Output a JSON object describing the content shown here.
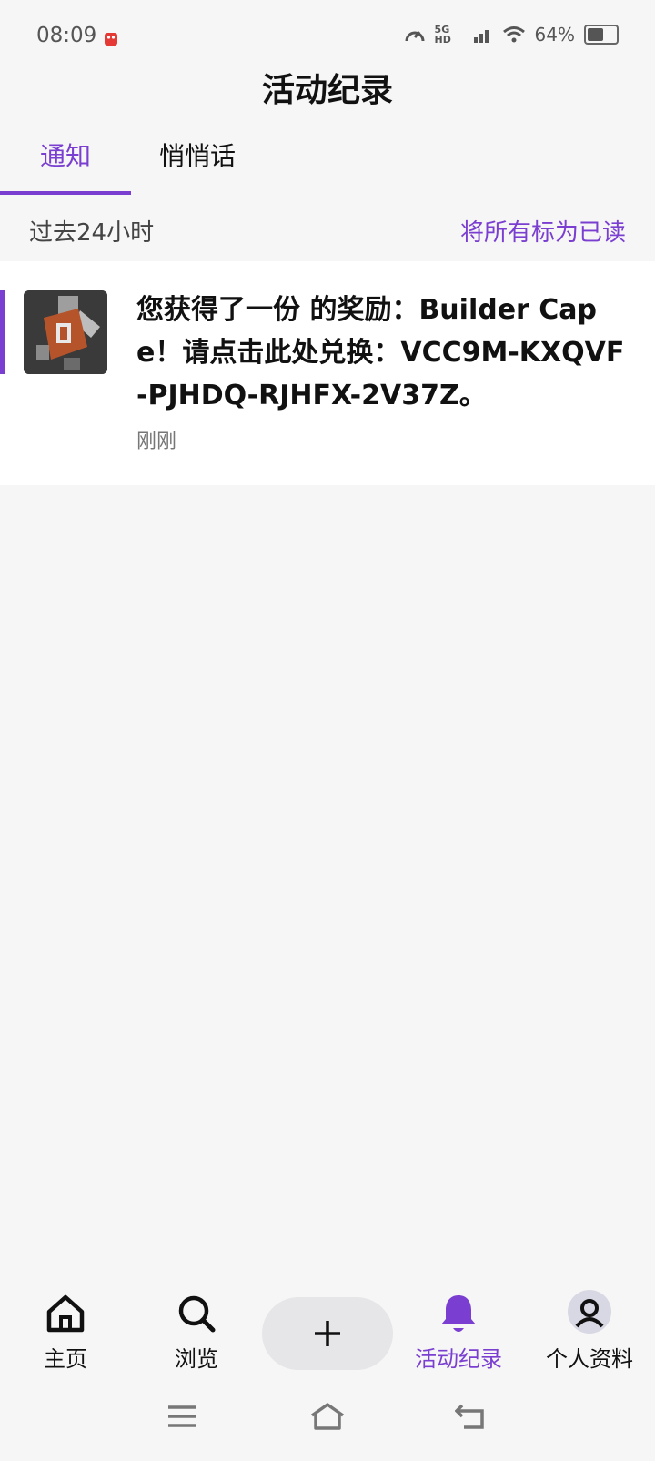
{
  "status_bar": {
    "time": "08:09",
    "network": "5G HD",
    "battery": "64%",
    "battery_level": 0.64
  },
  "header": {
    "title": "活动纪录"
  },
  "tabs": [
    {
      "label": "通知",
      "active": true
    },
    {
      "label": "悄悄话",
      "active": false
    }
  ],
  "section": {
    "label": "过去24小时",
    "mark_all_read": "将所有标为已读"
  },
  "notifications": [
    {
      "text": "您获得了一份 的奖励：Builder Cape！请点击此处兑换：VCC9M-KXQVF-PJHDQ-RJHFX-2V37Z。",
      "time": "刚刚",
      "unread": true
    }
  ],
  "bottom_nav": {
    "items": [
      {
        "label": "主页",
        "icon": "home-icon"
      },
      {
        "label": "浏览",
        "icon": "search-icon"
      },
      {
        "label": "",
        "icon": "plus-icon"
      },
      {
        "label": "活动纪录",
        "icon": "bell-icon",
        "active": true
      },
      {
        "label": "个人资料",
        "icon": "profile-icon"
      }
    ]
  },
  "colors": {
    "accent": "#7a3fd0",
    "background": "#f6f6f6",
    "card": "#ffffff"
  }
}
